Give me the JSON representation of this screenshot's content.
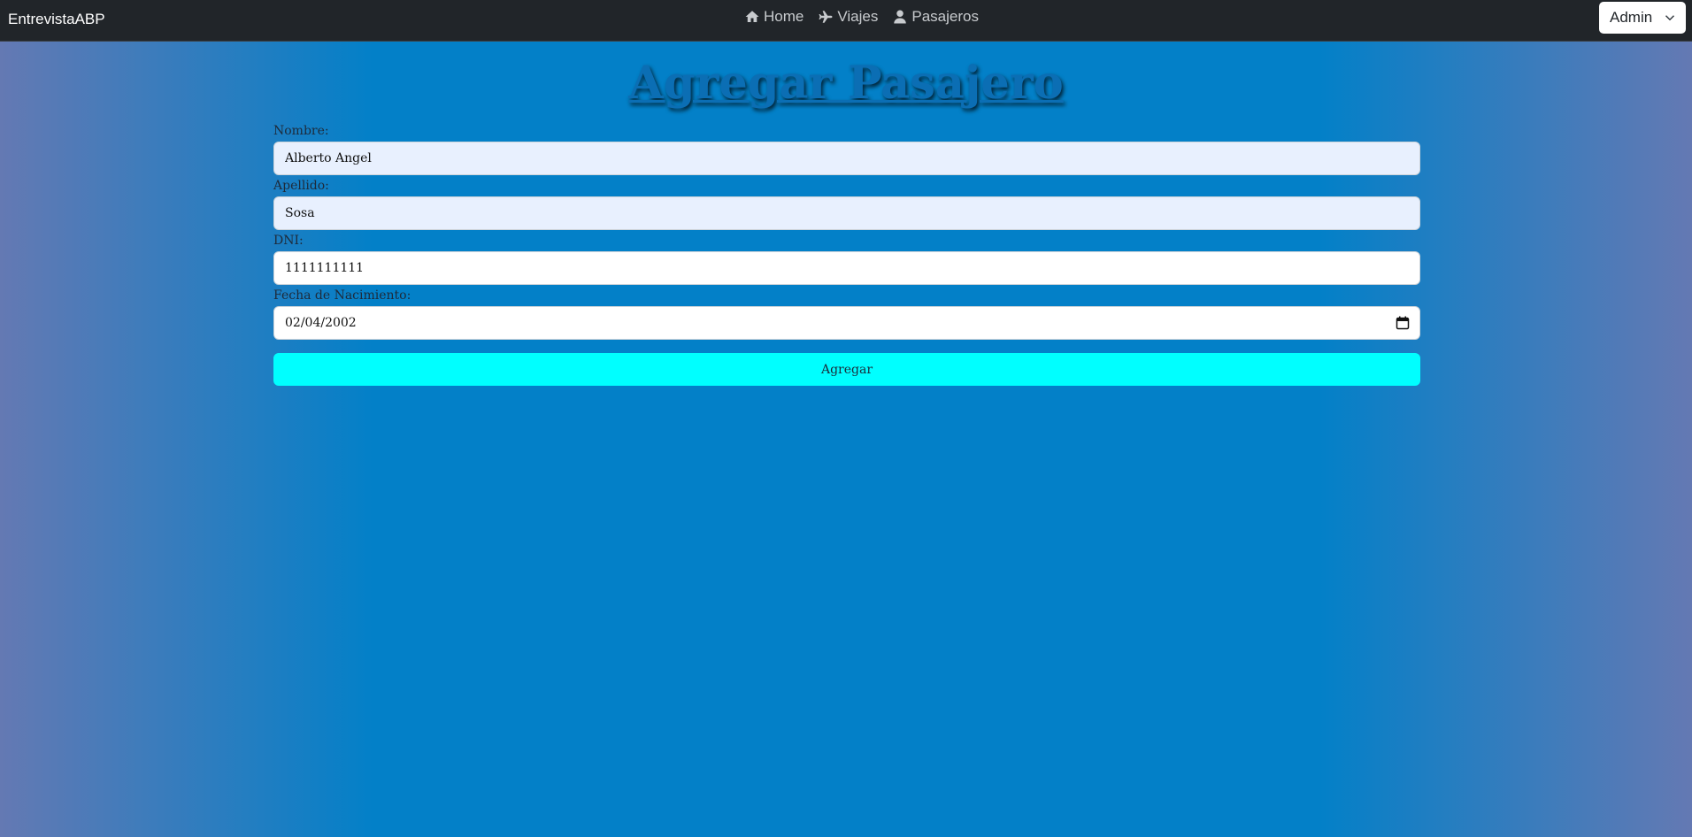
{
  "navbar": {
    "brand": "EntrevistaABP",
    "links": [
      {
        "label": "Home",
        "icon": "home-icon"
      },
      {
        "label": "Viajes",
        "icon": "plane-icon"
      },
      {
        "label": "Pasajeros",
        "icon": "user-icon"
      }
    ],
    "user_menu": {
      "selected": "Admin",
      "icon": "chevron-down-icon"
    }
  },
  "page": {
    "title": "Agregar Pasajero"
  },
  "form": {
    "nombre": {
      "label": "Nombre:",
      "value": "Alberto Angel"
    },
    "apellido": {
      "label": "Apellido:",
      "value": "Sosa"
    },
    "dni": {
      "label": "DNI:",
      "value": "1111111111"
    },
    "fecha": {
      "label": "Fecha de Nacimiento:",
      "value": "02/04/2002",
      "icon": "calendar-icon"
    },
    "submit_label": "Agregar"
  },
  "colors": {
    "navbar_bg": "#212529",
    "background_center": "#0380c8",
    "background_edge": "#6479b3",
    "button_bg": "#00ffff",
    "autofill_bg": "#e8f0fe"
  }
}
